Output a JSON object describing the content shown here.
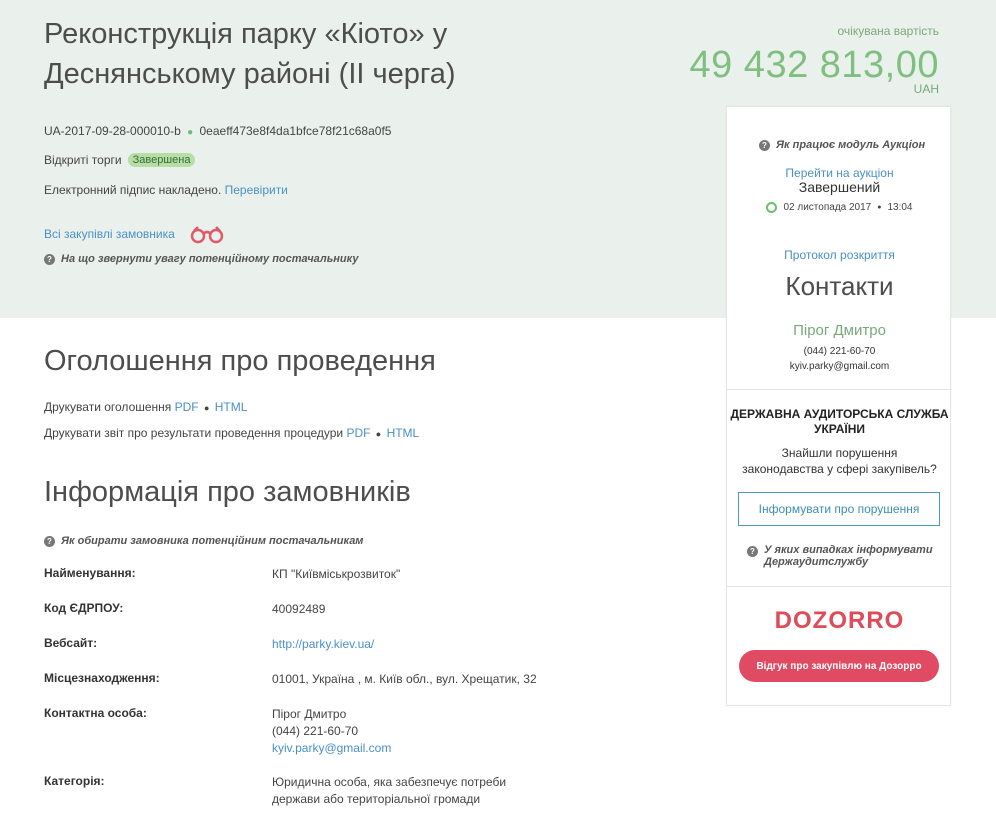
{
  "header": {
    "title": "Реконструкція парку «Кіото» у Деснянському районі (II черга)",
    "price_label": "очікувана вартість",
    "price": "49 432 813,00",
    "currency": "UAH",
    "tender_id": "UA-2017-09-28-000010-b",
    "tender_hash": "0eaeff473e8f4da1bfce78f21c68a0f5",
    "procedure": "Відкриті торги",
    "status_badge": "Завершена",
    "signature_text": "Електронний підпис накладено.",
    "signature_link": "Перевірити",
    "all_purchases_link": "Всі закупівлі замовника",
    "attention_hint": "На що звернути увагу потенційному постачальнику"
  },
  "announcement": {
    "title": "Оголошення про проведення",
    "print_announcement": "Друкувати оголошення",
    "print_report": "Друкувати звіт про результати проведення процедури",
    "pdf": "PDF",
    "html": "HTML"
  },
  "customer": {
    "title": "Інформація про замовників",
    "hint": "Як обирати замовника потенційним постачальникам",
    "rows": [
      {
        "key": "Найменування:",
        "value": "КП \"Київміськрозвиток\""
      },
      {
        "key": "Код ЄДРПОУ:",
        "value": "40092489"
      },
      {
        "key": "Вебсайт:",
        "value": "http://parky.kiev.ua/"
      },
      {
        "key": "Місцезнаходження:",
        "value": "01001, Україна , м. Київ обл., вул. Хрещатик, 32"
      },
      {
        "key": "Контактна особа:",
        "value_name": "Пірог Дмитро",
        "value_phone": "(044) 221-60-70",
        "value_email": "kyiv.parky@gmail.com"
      },
      {
        "key": "Категорія:",
        "value_line1": "Юридична особа, яка забезпечує потреби",
        "value_line2": "держави або територіальної громади"
      }
    ]
  },
  "sidebar": {
    "auction_hint": "Як працює модуль Аукціон",
    "auction_link": "Перейти на аукціон",
    "auction_status": "Завершений",
    "auction_date": "02 листопада 2017",
    "auction_time": "13:04",
    "protocol_link": "Протокол розкриття",
    "contacts_title": "Контакти",
    "contact_name": "Пірог Дмитро",
    "contact_phone": "(044) 221-60-70",
    "contact_email": "kyiv.parky@gmail.com",
    "audit_title_line1": "ДЕРЖАВНА АУДИТОРСЬКА СЛУЖБА",
    "audit_title_line2": "УКРАЇНИ",
    "audit_text_line1": "Знайшли порушення",
    "audit_text_line2": "законодавства у сфері закупівель?",
    "audit_button": "Інформувати про порушення",
    "audit_hint_line1": "У яких випадках інформувати",
    "audit_hint_line2": "Держаудитслужбу",
    "dozorro_logo": "DOZORRO",
    "dozorro_button": "Відгук про закупівлю на Дозорро"
  },
  "colors": {
    "hero_bg": "#eaf1ec",
    "price_green": "#7fbf7f",
    "link_blue": "#4a90c8",
    "dozorro_red": "#e04b5a"
  }
}
